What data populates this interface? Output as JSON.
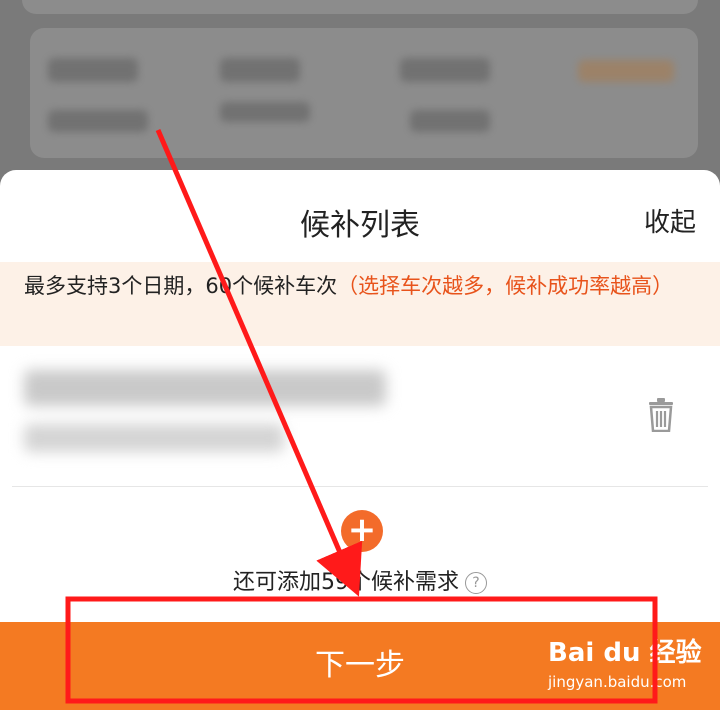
{
  "sheet": {
    "title": "候补列表",
    "collapse_label": "收起"
  },
  "notice": {
    "text": "最多支持3个日期，60个候补车次",
    "emphasis": "（选择车次越多，候补成功率越高）"
  },
  "add": {
    "icon": "plus-icon",
    "remaining_text": "还可添加59个候补需求",
    "help_glyph": "?"
  },
  "next_button": {
    "label": "下一步"
  },
  "watermark": {
    "brand": "Bai du 经验",
    "url": "jingyan.baidu.com"
  },
  "colors": {
    "accent": "#f47a22",
    "notice_bg": "#fdf1e7",
    "notice_emphasis": "#e8531b",
    "annotation_red": "#ff1a1a"
  }
}
